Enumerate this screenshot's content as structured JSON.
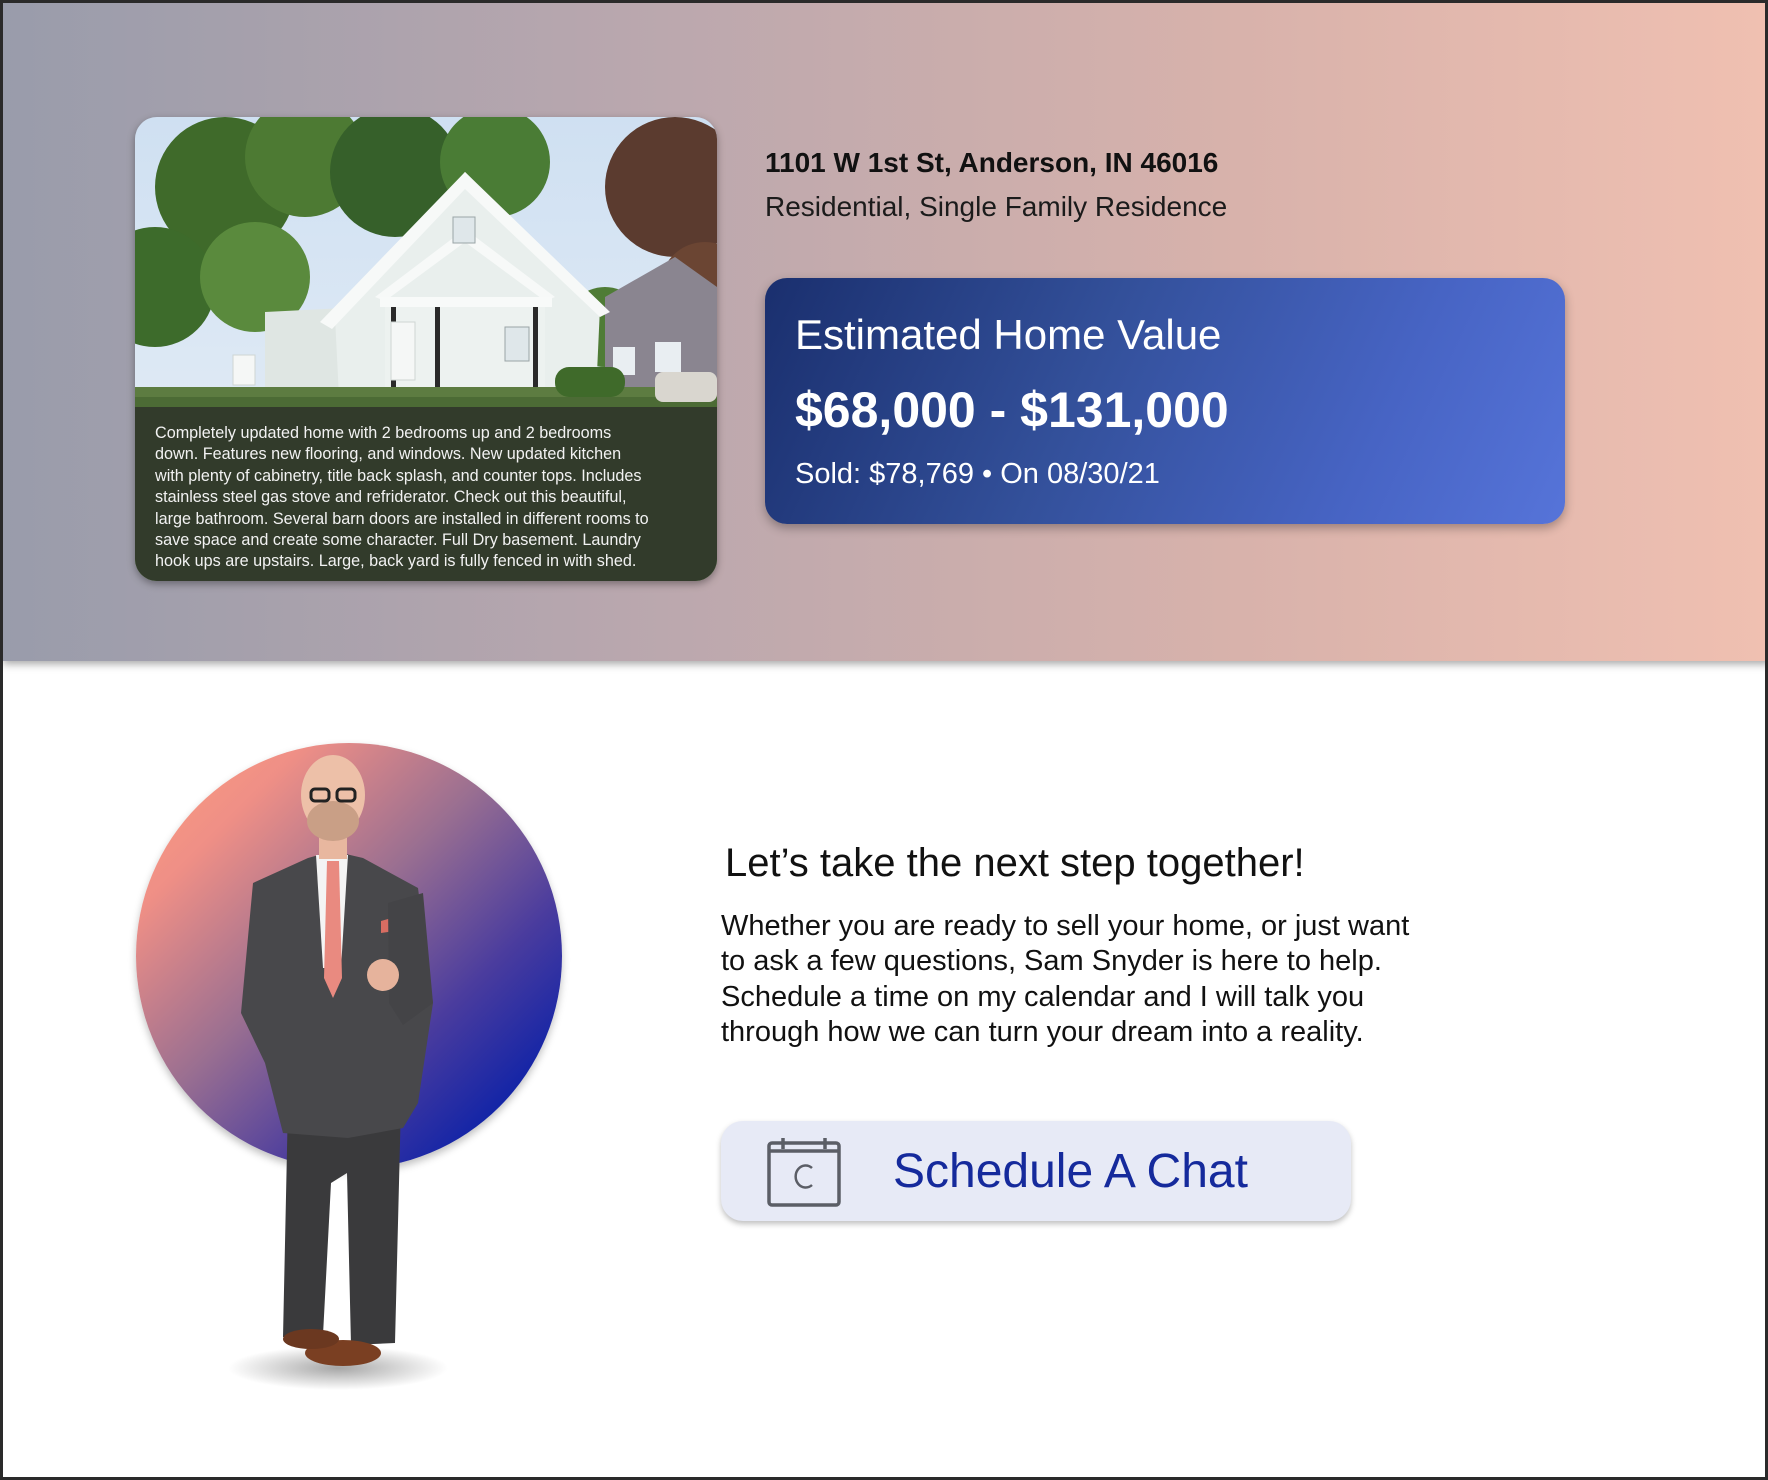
{
  "listing": {
    "address": "1101 W 1st St, Anderson, IN 46016",
    "property_type": "Residential, Single Family Residence",
    "description_lines": [
      "Completely updated home with 2 bedrooms up and 2 bedrooms",
      "down. Features new flooring, and windows. New updated kitchen",
      "with plenty of cabinetry, title back splash, and counter tops. Includes",
      "stainless steel gas stove and refriderator. Check out this beautiful,",
      "large bathroom. Several barn doors are installed in different rooms to",
      "save space and create some character. Full Dry basement. Laundry",
      "hook ups are upstairs. Large, back yard is fully fenced in with shed."
    ]
  },
  "valuation": {
    "label": "Estimated Home Value",
    "range": "$68,000 - $131,000",
    "sold_line": "Sold: $78,769 • On 08/30/21"
  },
  "cta": {
    "title": "Let’s take the next step together!",
    "body_lines": [
      "Whether you are ready to sell your home, or just want",
      "to ask a few questions, Sam Snyder is here to help.",
      "Schedule a time on my calendar and I will talk you",
      "through how we can turn your dream into a reality."
    ],
    "button_label": "Schedule A Chat",
    "button_icon": "calendar-icon"
  },
  "colors": {
    "value_card_start": "#1a2f6e",
    "value_card_end": "#5674d9",
    "button_bg": "#e7eaf6",
    "button_text": "#152a9c",
    "circle_start": "#ffa07f",
    "circle_end": "#001f9e"
  }
}
